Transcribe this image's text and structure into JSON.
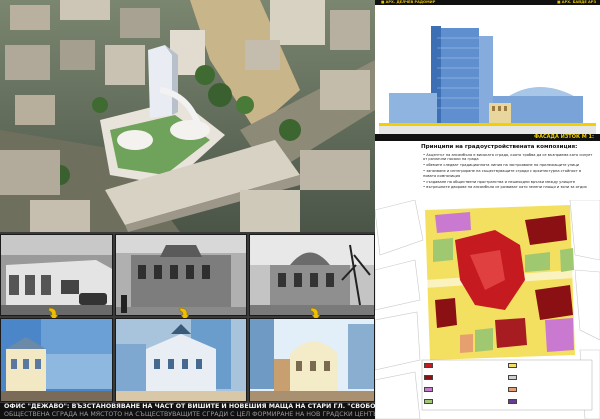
{
  "header": {
    "left_label": "■ АРХ. ДЕЛЧЕВ РАДОМИР",
    "right_label": "■ АРХ. БАЙДЕ АРЗ"
  },
  "facade": {
    "label": "ФАСАДА ИЗТОК М 1:"
  },
  "principles": {
    "title": "Принципи на градоустройствената композиция:",
    "items": [
      "• Акцентът на ансамбъла е високата сграда, която трябва да се възприема като силует от различни посоки на града",
      "• обемите следват традиционната линия на застрояване по прилежащите улици",
      "• запазване и интегриране на съществуващите сгради с архитектурна стойност в новата композиция",
      "• създаване на обществени пространства и пешеходни връзки между улиците",
      "• вътрешните дворове на ансамбъла се развиват като зелени площи и зони за отдих"
    ]
  },
  "legend": {
    "items": [
      {
        "label": "",
        "color": "#c41a20"
      },
      {
        "label": "",
        "color": "#8a1014"
      },
      {
        "label": "",
        "color": "#c97ad0"
      },
      {
        "label": "",
        "color": "#a0c870"
      },
      {
        "label": "",
        "color": "#f3e060"
      },
      {
        "label": "",
        "color": "#d0d0d0"
      },
      {
        "label": "",
        "color": "#e6a070"
      },
      {
        "label": "",
        "color": "#6a3a9a"
      }
    ]
  },
  "caption": {
    "line1": "ОФИС \"ДЕЖАВО\": ВЪЗСТАНОВЯВАНЕ НА ЧАСТ ОТ ВИШИТЕ И НОВЕШИЯ МАЩА НА СТАРИ ГЛ. \"СВОБОДА\" ЧРЕЗ ИЗГРАЖДАНЕ И НОВАТА",
    "line2": "ОБЩЕСТВЕНА СГРАДА НА МЯСТОТО НА СЪЩЕСТВУВАЩИТЕ СГРАДИ С ЦЕЛ ФОРМИРАНЕ НА НОВ ГРАДСКИ ЦЕНТЪР НА ГР. РУСЕ"
  }
}
